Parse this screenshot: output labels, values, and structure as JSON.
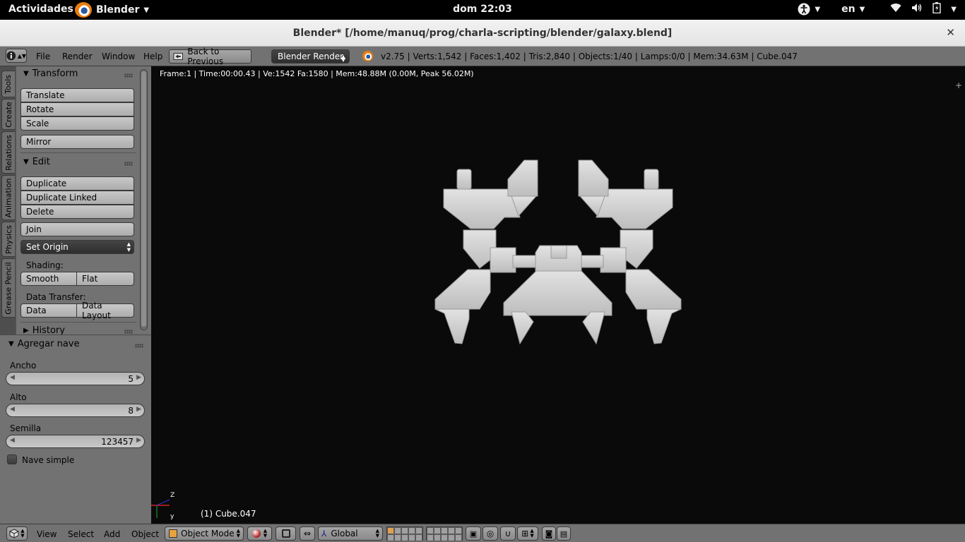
{
  "gnome": {
    "activities": "Actividades",
    "app_name": "Blender",
    "clock": "dom 22:03",
    "lang": "en"
  },
  "window": {
    "title": "Blender* [/home/manuq/prog/charla-scripting/blender/galaxy.blend]"
  },
  "info": {
    "menus": [
      "File",
      "Render",
      "Window",
      "Help"
    ],
    "back_label": "Back to Previous",
    "engine": "Blender Render",
    "stats": "v2.75 | Verts:1,542 | Faces:1,402 | Tris:2,840 | Objects:1/40 | Lamps:0/0 | Mem:34.63M | Cube.047"
  },
  "tabs": [
    "Tools",
    "Create",
    "Relations",
    "Animation",
    "Physics",
    "Grease Pencil"
  ],
  "tools": {
    "transform_title": "Transform",
    "translate": "Translate",
    "rotate": "Rotate",
    "scale": "Scale",
    "mirror": "Mirror",
    "edit_title": "Edit",
    "duplicate": "Duplicate",
    "duplicate_linked": "Duplicate Linked",
    "delete": "Delete",
    "join": "Join",
    "set_origin": "Set Origin",
    "shading_label": "Shading:",
    "smooth": "Smooth",
    "flat": "Flat",
    "data_transfer_label": "Data Transfer:",
    "data": "Data",
    "data_layout": "Data Layout",
    "history_title": "History"
  },
  "operator": {
    "title": "Agregar nave",
    "ancho_label": "Ancho",
    "ancho_value": "5",
    "alto_label": "Alto",
    "alto_value": "8",
    "semilla_label": "Semilla",
    "semilla_value": "123457",
    "nave_simple_label": "Nave simple",
    "nave_simple_checked": false
  },
  "viewport": {
    "info": "Frame:1 | Time:00:00.43 | Ve:1542 Fa:1580 | Mem:48.88M (0.00M, Peak 56.02M)",
    "object_label": "(1) Cube.047",
    "axis_z": "Z",
    "axis_y": "y"
  },
  "bottom": {
    "menus": [
      "View",
      "Select",
      "Add",
      "Object"
    ],
    "mode": "Object Mode",
    "orientation": "Global"
  },
  "colors": {
    "panel": "#727272",
    "viewport": "#0a0a0a",
    "model": "#d6d6d6",
    "blender_orange": "#e87d0d"
  }
}
